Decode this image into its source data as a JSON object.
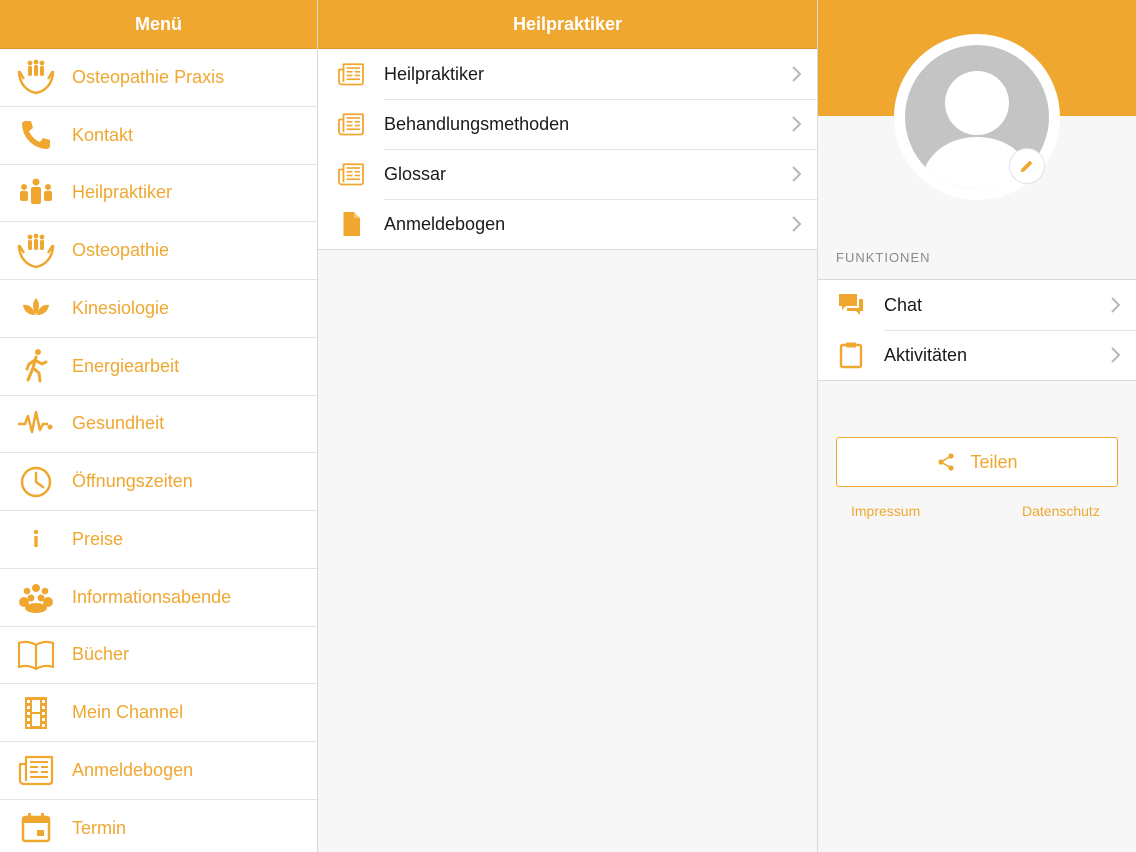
{
  "colors": {
    "accent": "#efa730"
  },
  "menu": {
    "title": "Menü",
    "items": [
      {
        "label": "Osteopathie Praxis",
        "icon": "hands-people-icon"
      },
      {
        "label": "Kontakt",
        "icon": "phone-icon"
      },
      {
        "label": "Heilpraktiker",
        "icon": "people-icon"
      },
      {
        "label": "Osteopathie",
        "icon": "hands-people-icon"
      },
      {
        "label": "Kinesiologie",
        "icon": "lotus-icon"
      },
      {
        "label": "Energiearbeit",
        "icon": "walking-icon"
      },
      {
        "label": "Gesundheit",
        "icon": "heartbeat-icon"
      },
      {
        "label": "Öffnungszeiten",
        "icon": "clock-icon"
      },
      {
        "label": "Preise",
        "icon": "info-icon"
      },
      {
        "label": "Informationsabende",
        "icon": "group-icon"
      },
      {
        "label": "Bücher",
        "icon": "book-icon"
      },
      {
        "label": "Mein Channel",
        "icon": "film-icon"
      },
      {
        "label": "Anmeldebogen",
        "icon": "newspaper-icon"
      },
      {
        "label": "Termin",
        "icon": "calendar-icon"
      }
    ]
  },
  "main": {
    "title": "Heilpraktiker",
    "items": [
      {
        "label": "Heilpraktiker",
        "icon": "newspaper-icon"
      },
      {
        "label": "Behandlungsmethoden",
        "icon": "newspaper-icon"
      },
      {
        "label": "Glossar",
        "icon": "newspaper-icon"
      },
      {
        "label": "Anmeldebogen",
        "icon": "document-icon"
      }
    ]
  },
  "profile": {
    "section_title": "FUNKTIONEN",
    "functions": [
      {
        "label": "Chat",
        "icon": "chat-icon"
      },
      {
        "label": "Aktivitäten",
        "icon": "clipboard-icon"
      }
    ],
    "share_label": "Teilen",
    "impressum": "Impressum",
    "datenschutz": "Datenschutz"
  }
}
